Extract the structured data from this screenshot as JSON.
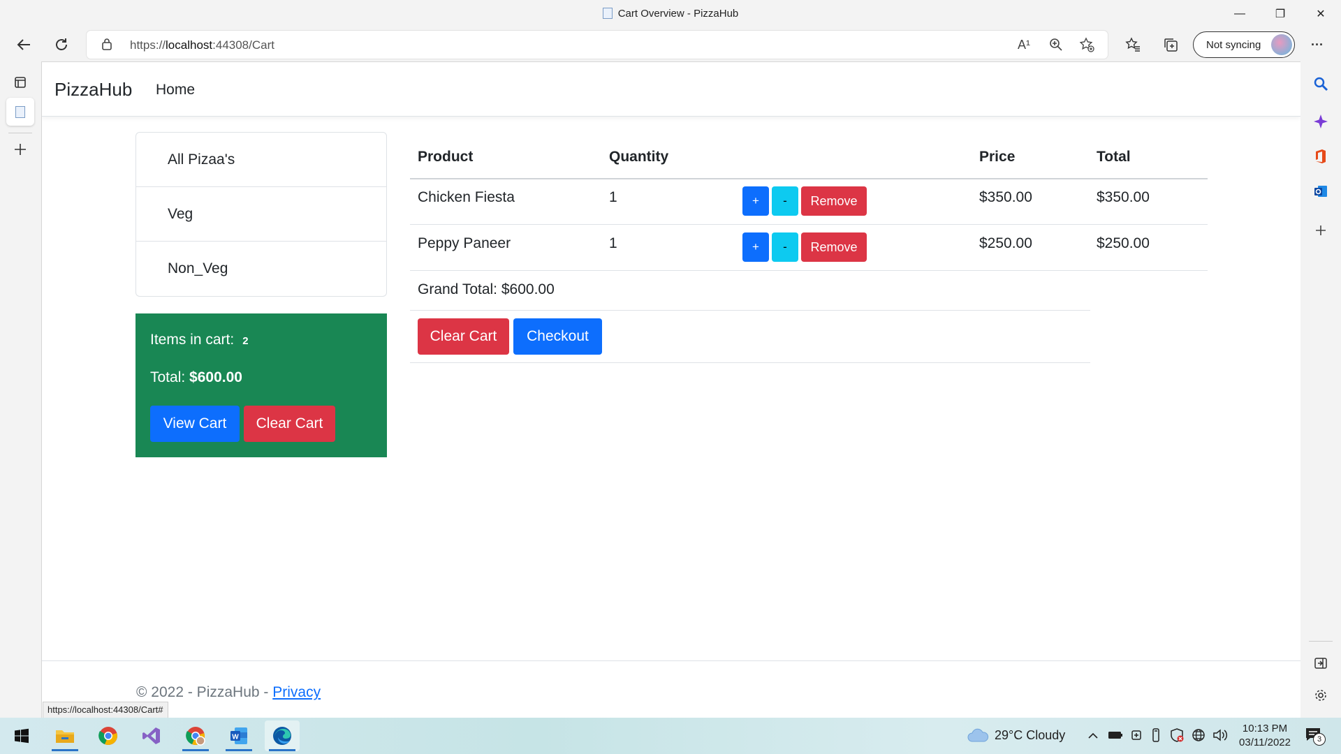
{
  "window": {
    "title": "Cart Overview - PizzaHub",
    "minimize_glyph": "—",
    "restore_glyph": "❐",
    "close_glyph": "✕"
  },
  "browser": {
    "url_prefix": "https://",
    "url_host": "localhost",
    "url_rest": ":44308/Cart",
    "read_aloud_glyph": "A¹",
    "sync_label": "Not syncing",
    "more_glyph": "···"
  },
  "navbar": {
    "brand": "PizzaHub",
    "links": [
      "Home"
    ]
  },
  "categories": [
    "All Pizaa's",
    "Veg",
    "Non_Veg"
  ],
  "cart_summary": {
    "items_label": "Items in cart:",
    "items_count": "2",
    "total_label": "Total:",
    "total_value": "$600.00",
    "view_cart_label": "View Cart",
    "clear_cart_label": "Clear Cart"
  },
  "cart_table": {
    "headers": {
      "product": "Product",
      "quantity": "Quantity",
      "price": "Price",
      "total": "Total"
    },
    "rows": [
      {
        "product": "Chicken Fiesta",
        "quantity": "1",
        "plus": "+",
        "minus": "-",
        "remove": "Remove",
        "price": "$350.00",
        "total": "$350.00"
      },
      {
        "product": "Peppy Paneer",
        "quantity": "1",
        "plus": "+",
        "minus": "-",
        "remove": "Remove",
        "price": "$250.00",
        "total": "$250.00"
      }
    ],
    "grand_total": "Grand Total: $600.00",
    "clear_cart_label": "Clear Cart",
    "checkout_label": "Checkout"
  },
  "footer": {
    "text": "© 2022 - PizzaHub - ",
    "privacy_link": "Privacy"
  },
  "status_url": "https://localhost:44308/Cart#",
  "taskbar": {
    "weather": "29°C  Cloudy",
    "time": "10:13 PM",
    "date": "03/11/2022",
    "notification_count": "3"
  },
  "colors": {
    "success": "#198754",
    "primary": "#0d6efd",
    "danger": "#dc3545",
    "info": "#0dcaf0"
  }
}
